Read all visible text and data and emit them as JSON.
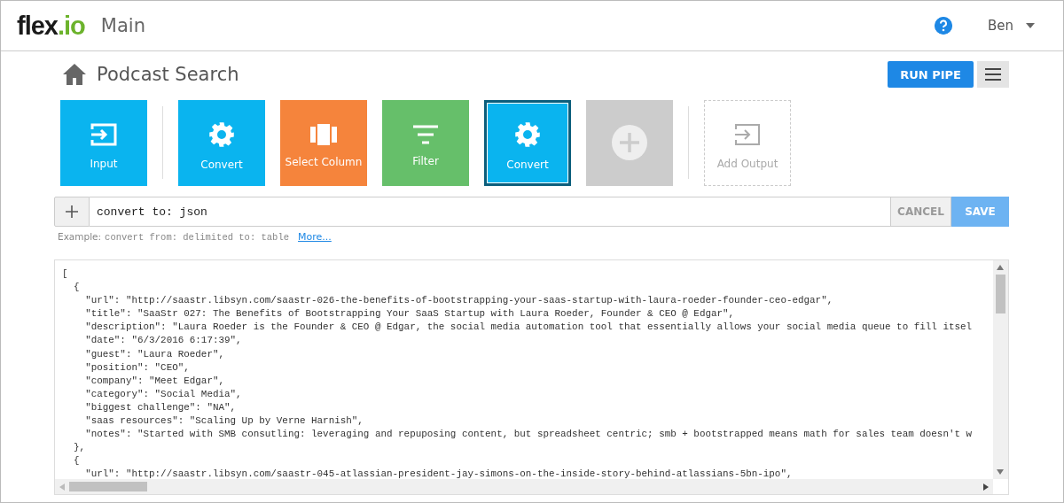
{
  "header": {
    "logo": {
      "main": "flex",
      "accent": ".io"
    },
    "title": "Main",
    "user": "Ben"
  },
  "pipe": {
    "title": "Podcast Search",
    "run_button": "RUN PIPE"
  },
  "tasks": [
    {
      "kind": "input",
      "label": "Input",
      "color": "#0ab4ef",
      "selected": false
    },
    {
      "kind": "convert",
      "label": "Convert",
      "color": "#0ab4ef",
      "selected": false
    },
    {
      "kind": "columns",
      "label": "Select Column",
      "color": "#f5843c",
      "selected": false
    },
    {
      "kind": "filter",
      "label": "Filter",
      "color": "#66bf6a",
      "selected": false
    },
    {
      "kind": "convert",
      "label": "Convert",
      "color": "#0ab4ef",
      "selected": true
    },
    {
      "kind": "add",
      "color": "#cccccc",
      "selected": false
    },
    {
      "kind": "output",
      "label": "Add Output",
      "selected": false
    }
  ],
  "command": {
    "value": "convert to: json",
    "cancel": "CANCEL",
    "save": "SAVE",
    "example_label": "Example:",
    "example": "convert from: delimited to: table",
    "more_link": "More..."
  },
  "output_lines": [
    "[",
    "  {",
    "    \"url\": \"http://saastr.libsyn.com/saastr-026-the-benefits-of-bootstrapping-your-saas-startup-with-laura-roeder-founder-ceo-edgar\",",
    "    \"title\": \"SaaStr 027: The Benefits of Bootstrapping Your SaaS Startup with Laura Roeder, Founder & CEO @ Edgar\",",
    "    \"description\": \"Laura Roeder is the Founder & CEO @ Edgar, the social media automation tool that essentially allows your social media queue to fill itsel",
    "    \"date\": \"6/3/2016 6:17:39\",",
    "    \"guest\": \"Laura Roeder\",",
    "    \"position\": \"CEO\",",
    "    \"company\": \"Meet Edgar\",",
    "    \"category\": \"Social Media\",",
    "    \"biggest challenge\": \"NA\",",
    "    \"saas resources\": \"Scaling Up by Verne Harnish\",",
    "    \"notes\": \"Started with SMB consutling: leveraging and repuposing content, but spreadsheet centric; smb + bootstrapped means math for sales team doesn't w",
    "  },",
    "  {",
    "    \"url\": \"http://saastr.libsyn.com/saastr-045-atlassian-president-jay-simons-on-the-inside-story-behind-atlassians-5bn-ipo\","
  ]
}
